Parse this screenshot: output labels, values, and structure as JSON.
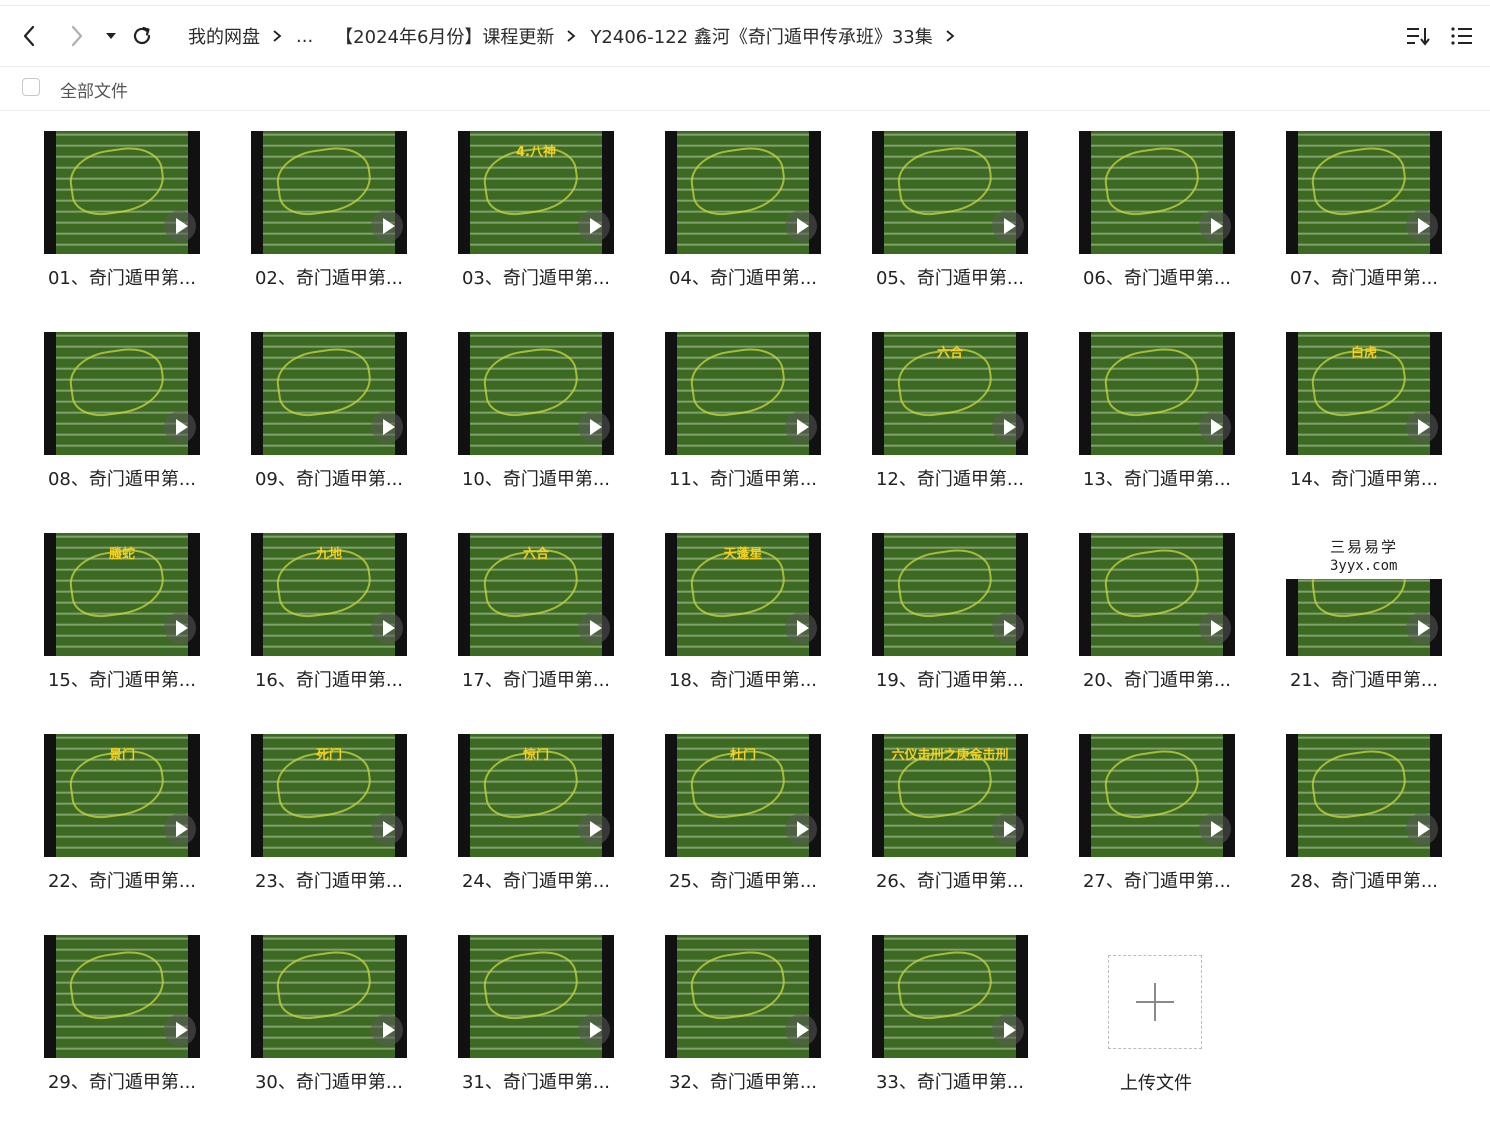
{
  "toolbar": {
    "back_icon": "chevron-left-icon",
    "forward_icon": "chevron-right-icon",
    "history_icon": "caret-down-icon",
    "refresh_icon": "refresh-icon",
    "sort_icon": "sort-icon",
    "view_icon": "list-view-icon"
  },
  "breadcrumb": {
    "items": [
      "我的网盘",
      "...",
      "【2024年6月份】课程更新",
      "Y2406-122 鑫河《奇门遁甲传承班》33集"
    ]
  },
  "selection": {
    "all_files_label": "全部文件"
  },
  "colors": {
    "board": "#3d6a23",
    "accent_yellow": "#f5d020",
    "text": "#222222"
  },
  "files": [
    {
      "name": "01、奇门遁甲第...",
      "thumb_title": ""
    },
    {
      "name": "02、奇门遁甲第...",
      "thumb_title": ""
    },
    {
      "name": "03、奇门遁甲第...",
      "thumb_title": "4.八神"
    },
    {
      "name": "04、奇门遁甲第...",
      "thumb_title": ""
    },
    {
      "name": "05、奇门遁甲第...",
      "thumb_title": ""
    },
    {
      "name": "06、奇门遁甲第...",
      "thumb_title": ""
    },
    {
      "name": "07、奇门遁甲第...",
      "thumb_title": ""
    },
    {
      "name": "08、奇门遁甲第...",
      "thumb_title": ""
    },
    {
      "name": "09、奇门遁甲第...",
      "thumb_title": ""
    },
    {
      "name": "10、奇门遁甲第...",
      "thumb_title": ""
    },
    {
      "name": "11、奇门遁甲第...",
      "thumb_title": ""
    },
    {
      "name": "12、奇门遁甲第...",
      "thumb_title": "六合"
    },
    {
      "name": "13、奇门遁甲第...",
      "thumb_title": ""
    },
    {
      "name": "14、奇门遁甲第...",
      "thumb_title": "白虎"
    },
    {
      "name": "15、奇门遁甲第...",
      "thumb_title": "螣蛇"
    },
    {
      "name": "16、奇门遁甲第...",
      "thumb_title": "九地"
    },
    {
      "name": "17、奇门遁甲第...",
      "thumb_title": "六合"
    },
    {
      "name": "18、奇门遁甲第...",
      "thumb_title": "天蓬星"
    },
    {
      "name": "19、奇门遁甲第...",
      "thumb_title": ""
    },
    {
      "name": "20、奇门遁甲第...",
      "thumb_title": ""
    },
    {
      "name": "21、奇门遁甲第...",
      "thumb_title": ""
    },
    {
      "name": "22、奇门遁甲第...",
      "thumb_title": "景门"
    },
    {
      "name": "23、奇门遁甲第...",
      "thumb_title": "死门"
    },
    {
      "name": "24、奇门遁甲第...",
      "thumb_title": "惊门"
    },
    {
      "name": "25、奇门遁甲第...",
      "thumb_title": "杜门"
    },
    {
      "name": "26、奇门遁甲第...",
      "thumb_title": "六仪击刑之庚金击刑"
    },
    {
      "name": "27、奇门遁甲第...",
      "thumb_title": ""
    },
    {
      "name": "28、奇门遁甲第...",
      "thumb_title": ""
    },
    {
      "name": "29、奇门遁甲第...",
      "thumb_title": ""
    },
    {
      "name": "30、奇门遁甲第...",
      "thumb_title": ""
    },
    {
      "name": "31、奇门遁甲第...",
      "thumb_title": ""
    },
    {
      "name": "32、奇门遁甲第...",
      "thumb_title": ""
    },
    {
      "name": "33、奇门遁甲第...",
      "thumb_title": ""
    }
  ],
  "upload": {
    "label": "上传文件",
    "icon": "plus-icon"
  },
  "watermark": {
    "line1": "三易易学",
    "line2": "3yyx.com"
  }
}
